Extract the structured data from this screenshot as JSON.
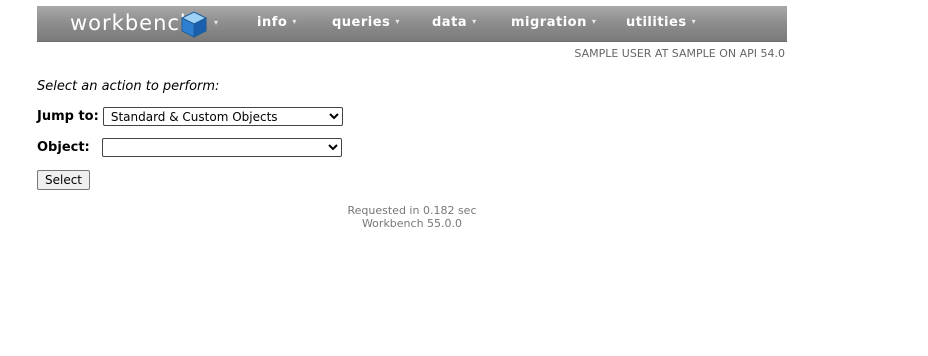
{
  "header": {
    "brand": "workbench",
    "menus": [
      {
        "label": "info"
      },
      {
        "label": "queries"
      },
      {
        "label": "data"
      },
      {
        "label": "migration"
      },
      {
        "label": "utilities"
      }
    ],
    "caret_glyph": "▾",
    "logo_icon": "cube-icon",
    "colors": {
      "navbar": "#8f8f8f",
      "logo": "#3b8fd8"
    }
  },
  "user_info": "SAMPLE USER AT SAMPLE ON API 54.0",
  "form": {
    "prompt": "Select an action to perform:",
    "jump_label": "Jump to:",
    "jump_value": "Standard & Custom Objects",
    "object_label": "Object:",
    "object_value": "",
    "submit_label": "Select"
  },
  "footer": {
    "request_time": "Requested in 0.182 sec",
    "version": "Workbench 55.0.0"
  }
}
